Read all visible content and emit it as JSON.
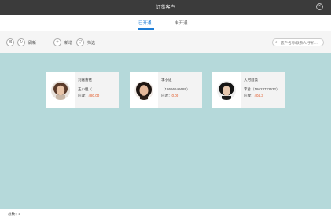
{
  "window": {
    "title": "订货客户",
    "close_glyph": "×"
  },
  "tabs": [
    {
      "label": "已开通",
      "active": true
    },
    {
      "label": "未开通",
      "active": false
    }
  ],
  "toolbar": {
    "refresh_label": "刷新",
    "add_label": "新增",
    "filter_label": "筛选",
    "search_placeholder": "客户名称/联系人/手机..."
  },
  "customers": [
    {
      "name": "刘嘉嘉花",
      "line2": "王小姐（...",
      "debt_label": "应收：",
      "amount": "480.00"
    },
    {
      "name": "李小姐",
      "line2": "（18666646689）",
      "debt_label": "应收：",
      "amount": "0.00"
    },
    {
      "name": "大河首美",
      "line2": "李总（18623722632）",
      "debt_label": "应收：",
      "amount": "404.3"
    }
  ],
  "footer": {
    "count_text": "总数：3"
  },
  "colors": {
    "accent": "#1e7dd6",
    "amount": "#e2531f",
    "titlebar": "#3b3b3b",
    "background": "#b5d9da"
  }
}
